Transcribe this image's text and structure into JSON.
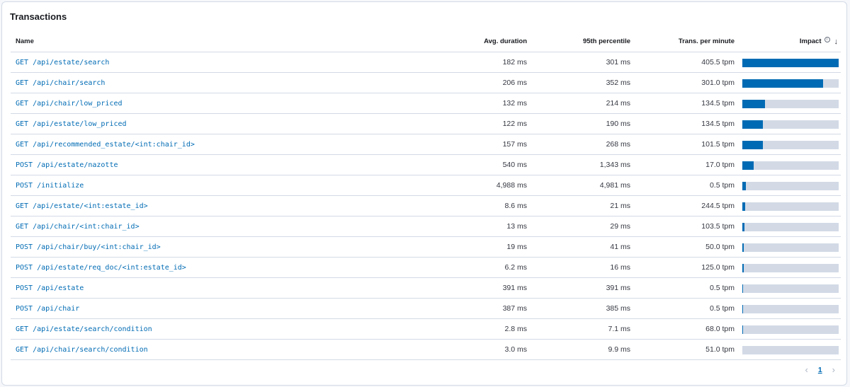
{
  "panel": {
    "title": "Transactions"
  },
  "table": {
    "headers": {
      "name": "Name",
      "avg": "Avg. duration",
      "p95": "95th percentile",
      "tpm": "Trans. per minute",
      "impact": "Impact"
    },
    "rows": [
      {
        "name": "GET /api/estate/search",
        "avg": "182 ms",
        "p95": "301 ms",
        "tpm": "405.5 tpm",
        "impact": 1.0
      },
      {
        "name": "GET /api/chair/search",
        "avg": "206 ms",
        "p95": "352 ms",
        "tpm": "301.0 tpm",
        "impact": 0.84
      },
      {
        "name": "GET /api/chair/low_priced",
        "avg": "132 ms",
        "p95": "214 ms",
        "tpm": "134.5 tpm",
        "impact": 0.235
      },
      {
        "name": "GET /api/estate/low_priced",
        "avg": "122 ms",
        "p95": "190 ms",
        "tpm": "134.5 tpm",
        "impact": 0.215
      },
      {
        "name": "GET /api/recommended_estate/<int:chair_id>",
        "avg": "157 ms",
        "p95": "268 ms",
        "tpm": "101.5 tpm",
        "impact": 0.21
      },
      {
        "name": "POST /api/estate/nazotte",
        "avg": "540 ms",
        "p95": "1,343 ms",
        "tpm": "17.0 tpm",
        "impact": 0.12
      },
      {
        "name": "POST /initialize",
        "avg": "4,988 ms",
        "p95": "4,981 ms",
        "tpm": "0.5 tpm",
        "impact": 0.035
      },
      {
        "name": "GET /api/estate/<int:estate_id>",
        "avg": "8.6 ms",
        "p95": "21 ms",
        "tpm": "244.5 tpm",
        "impact": 0.03
      },
      {
        "name": "GET /api/chair/<int:chair_id>",
        "avg": "13 ms",
        "p95": "29 ms",
        "tpm": "103.5 tpm",
        "impact": 0.02
      },
      {
        "name": "POST /api/chair/buy/<int:chair_id>",
        "avg": "19 ms",
        "p95": "41 ms",
        "tpm": "50.0 tpm",
        "impact": 0.015
      },
      {
        "name": "POST /api/estate/req_doc/<int:estate_id>",
        "avg": "6.2 ms",
        "p95": "16 ms",
        "tpm": "125.0 tpm",
        "impact": 0.014
      },
      {
        "name": "POST /api/estate",
        "avg": "391 ms",
        "p95": "391 ms",
        "tpm": "0.5 tpm",
        "impact": 0.008
      },
      {
        "name": "POST /api/chair",
        "avg": "387 ms",
        "p95": "385 ms",
        "tpm": "0.5 tpm",
        "impact": 0.008
      },
      {
        "name": "GET /api/estate/search/condition",
        "avg": "2.8 ms",
        "p95": "7.1 ms",
        "tpm": "68.0 tpm",
        "impact": 0.007
      },
      {
        "name": "GET /api/chair/search/condition",
        "avg": "3.0 ms",
        "p95": "9.9 ms",
        "tpm": "51.0 tpm",
        "impact": 0.0
      }
    ]
  },
  "pagination": {
    "current_page": "1",
    "prev_icon": "chevron-left-icon",
    "next_icon": "chevron-right-icon"
  },
  "colors": {
    "link": "#006bb4",
    "impact_fill": "#006bb4",
    "impact_track": "#d3dae6",
    "border": "#d3dae6"
  }
}
